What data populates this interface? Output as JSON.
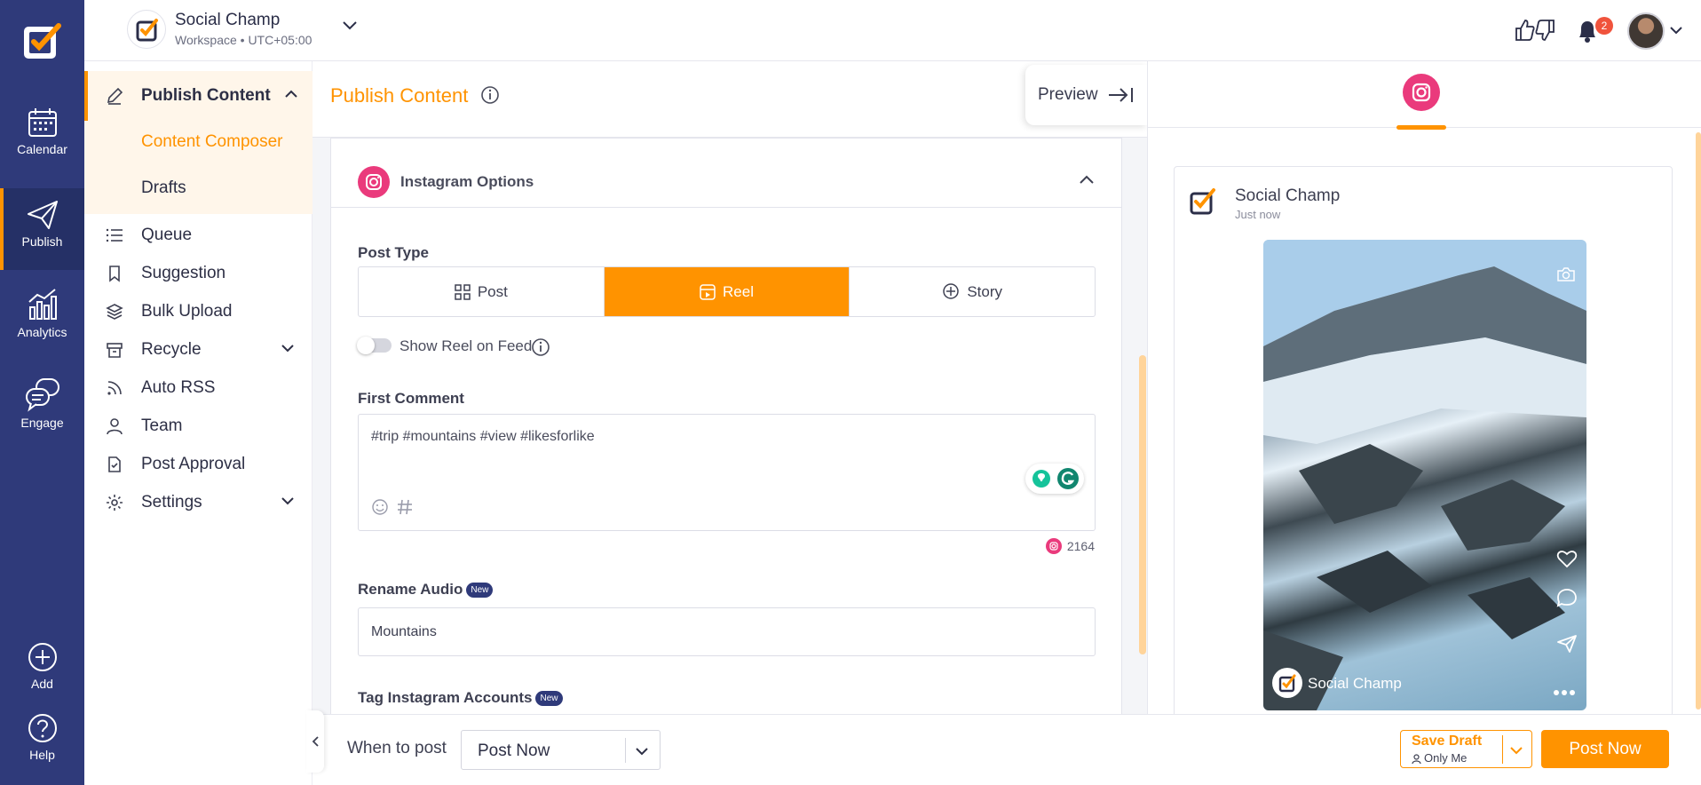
{
  "rail": {
    "items": [
      {
        "label": "Calendar",
        "icon": "calendar-icon"
      },
      {
        "label": "Publish",
        "icon": "paper-plane-icon",
        "active": true
      },
      {
        "label": "Analytics",
        "icon": "bar-chart-icon"
      },
      {
        "label": "Engage",
        "icon": "chat-bubbles-icon"
      },
      {
        "label": "Add",
        "icon": "plus-circle-icon"
      },
      {
        "label": "Help",
        "icon": "question-circle-icon"
      }
    ]
  },
  "workspace": {
    "name": "Social Champ",
    "sub": "Workspace • UTC+05:00"
  },
  "notifications": {
    "count": "2"
  },
  "subnav": {
    "section": "Publish Content",
    "children": [
      "Content Composer",
      "Drafts"
    ],
    "items": [
      "Queue",
      "Suggestion",
      "Bulk Upload",
      "Recycle",
      "Auto RSS",
      "Team",
      "Post Approval",
      "Settings"
    ]
  },
  "main": {
    "title": "Publish Content",
    "preview": "Preview"
  },
  "instagram": {
    "title": "Instagram Options",
    "post_type_label": "Post Type",
    "post_types": [
      "Post",
      "Reel",
      "Story"
    ],
    "selected_type": "Reel",
    "show_on_feed": "Show Reel on Feed",
    "first_comment_label": "First Comment",
    "first_comment": "#trip #mountains #view #likesforlike",
    "char_count": "2164",
    "rename_audio_label": "Rename Audio",
    "new_badge": "New",
    "audio_name": "Mountains",
    "tag_accounts_label": "Tag Instagram Accounts"
  },
  "preview": {
    "account": "Social Champ",
    "time": "Just now",
    "reel_user": "Social Champ"
  },
  "bottom": {
    "when_label": "When to post",
    "when_value": "Post Now",
    "save_draft": "Save Draft",
    "visibility": "Only Me",
    "post_now": "Post Now"
  },
  "colors": {
    "accent": "#ff9300",
    "rail": "#2f3a7a",
    "instagram": "#ea3a7c"
  }
}
